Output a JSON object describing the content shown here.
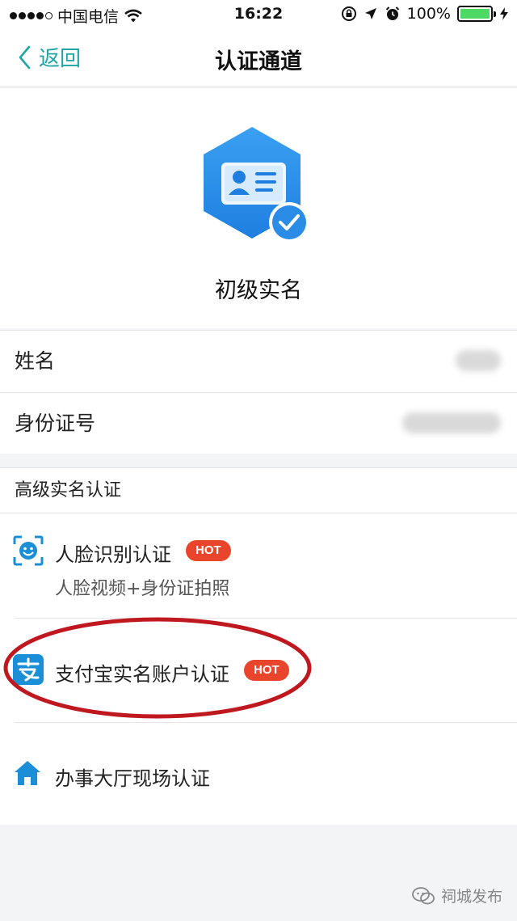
{
  "status_bar": {
    "carrier": "中国电信",
    "time": "16:22",
    "battery": "100%"
  },
  "nav": {
    "back_label": "返回",
    "title": "认证通道"
  },
  "hero": {
    "level": "初级实名"
  },
  "info": {
    "name_label": "姓名",
    "id_label": "身份证号"
  },
  "advanced": {
    "title": "高级实名认证",
    "options": [
      {
        "label": "人脸识别认证",
        "badge": "HOT",
        "sub": "人脸视频+身份证拍照",
        "icon": "face-scan-icon"
      },
      {
        "label": "支付宝实名账户认证",
        "badge": "HOT",
        "icon": "alipay-icon"
      },
      {
        "label": "办事大厅现场认证",
        "icon": "house-icon"
      }
    ]
  },
  "watermark": "祠城发布",
  "colors": {
    "accent": "#1fa5a5",
    "hex_blue": "#2b8ce8",
    "hot_badge": "#e8452c",
    "annotation": "#c0181f"
  }
}
